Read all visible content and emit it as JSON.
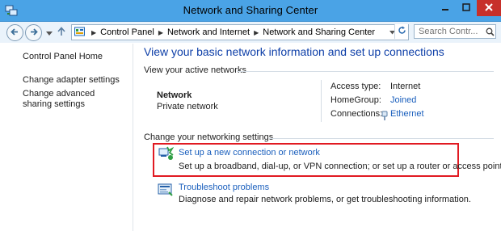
{
  "window": {
    "title": "Network and Sharing Center",
    "controls": {
      "minimize": "minimize-icon",
      "maximize": "maximize-icon",
      "close": "close-icon"
    }
  },
  "toolbar": {
    "address": {
      "breadcrumbs": [
        "Control Panel",
        "Network and Internet",
        "Network and Sharing Center"
      ]
    },
    "search": {
      "placeholder": "Search Contr..."
    }
  },
  "sidebar": {
    "items": [
      {
        "label": "Control Panel Home"
      },
      {
        "label": "Change adapter settings"
      },
      {
        "label": "Change advanced sharing settings"
      }
    ]
  },
  "main": {
    "heading": "View your basic network information and set up connections",
    "active_networks": {
      "section_label": "View your active networks",
      "network_name": "Network",
      "network_category": "Private network",
      "access_type_label": "Access type:",
      "access_type_value": "Internet",
      "homegroup_label": "HomeGroup:",
      "homegroup_value": "Joined",
      "connections_label": "Connections:",
      "connections_value": "Ethernet"
    },
    "settings": {
      "section_label": "Change your networking settings",
      "tasks": [
        {
          "title": "Set up a new connection or network",
          "description": "Set up a broadband, dial-up, or VPN connection; or set up a router or access point."
        },
        {
          "title": "Troubleshoot problems",
          "description": "Diagnose and repair network problems, or get troubleshooting information."
        }
      ]
    }
  },
  "colors": {
    "titlebar": "#4aa3e6",
    "close_button": "#c7302a",
    "link": "#1a5fbd",
    "heading": "#0e3fa8",
    "highlight_border": "#e11a22"
  }
}
